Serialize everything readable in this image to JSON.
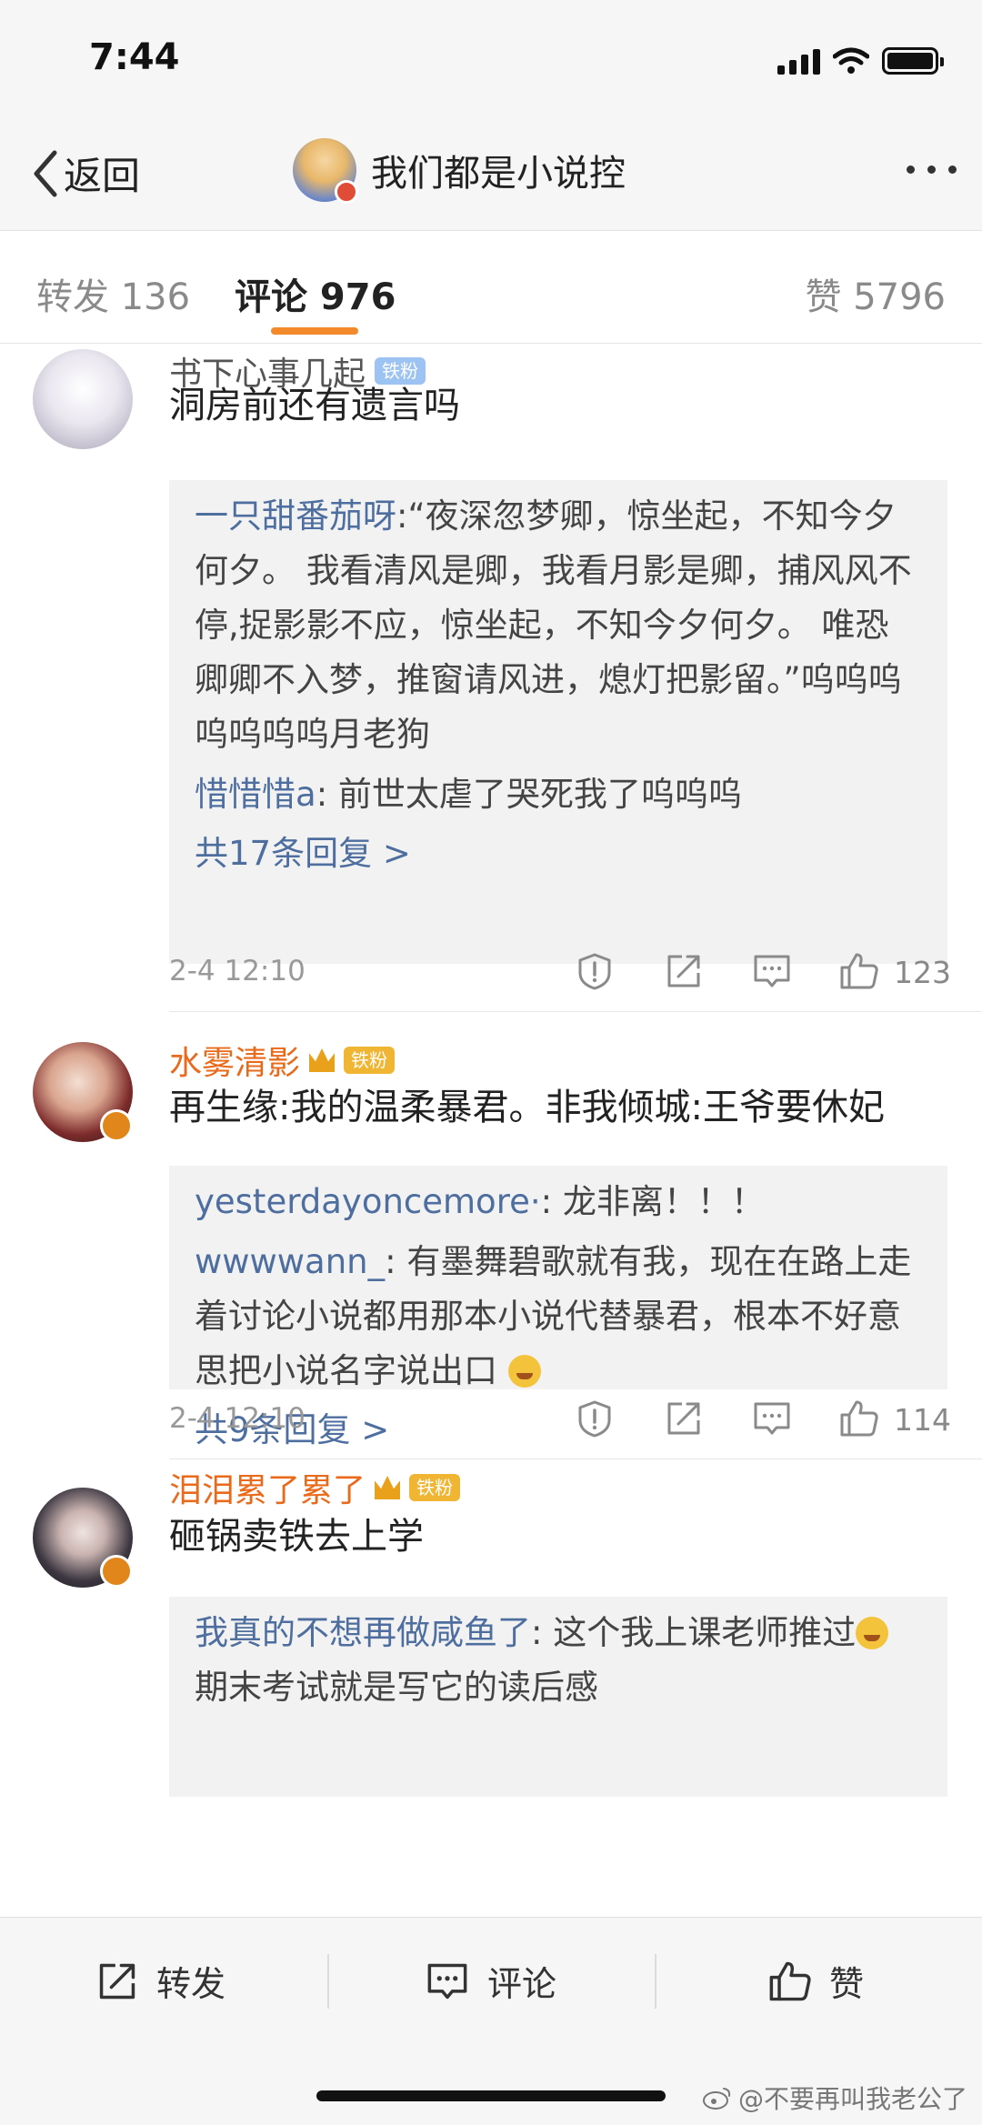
{
  "status_bar": {
    "time": "7:44"
  },
  "nav": {
    "back_label": "返回",
    "title": "我们都是小说控"
  },
  "tabs": [
    {
      "label": "转发 136"
    },
    {
      "label": "评论 976"
    },
    {
      "label": "赞 5796"
    }
  ],
  "comments": [
    {
      "username": "书下心事几起",
      "badge": "铁粉",
      "text": "洞房前还有遗言吗",
      "replies": [
        {
          "user": "一只甜番茄呀",
          "text": ":“夜深忽梦卿，惊坐起，不知今夕何夕。    我看清风是卿，我看月影是卿，捕风风不停,捉影影不应，惊坐起，不知今夕何夕。    唯恐卿卿不入梦，推窗请风进，熄灯把影留。”呜呜呜呜呜呜呜月老狗"
        },
        {
          "user": "惜惜惜a",
          "text": ": 前世太虐了哭死我了呜呜呜"
        }
      ],
      "more_replies": "共17条回复 >",
      "date": "2-4 12:10",
      "likes": "123"
    },
    {
      "username": "水雾清影",
      "badge": "铁粉",
      "text": "再生缘:我的温柔暴君。非我倾城:王爷要休妃",
      "replies": [
        {
          "user": "yesterdayoncemore·",
          "text": ": 龙非离！！！"
        },
        {
          "user": "wwwwann_",
          "text": ": 有墨舞碧歌就有我，现在在路上走着讨论小说都用那本小说代替暴君，根本不好意思把小说名字说出口"
        }
      ],
      "more_replies": "共9条回复 >",
      "date": "2-4 12:10",
      "likes": "114"
    },
    {
      "username": "泪泪累了累了",
      "badge": "铁粉",
      "text": "砸锅卖铁去上学",
      "replies": [
        {
          "user": "我真的不想再做咸鱼了",
          "text": ": 这个我上课老师推过",
          "text2": "期末考试就是写它的读后感"
        }
      ]
    }
  ],
  "bottom_bar": {
    "repost_label": "转发",
    "comment_label": "评论",
    "like_label": "赞"
  },
  "watermark": "@不要再叫我老公了",
  "colors": {
    "accent": "#f28a2c",
    "link": "#4d6e9e",
    "username_vip": "#e86a1a"
  }
}
